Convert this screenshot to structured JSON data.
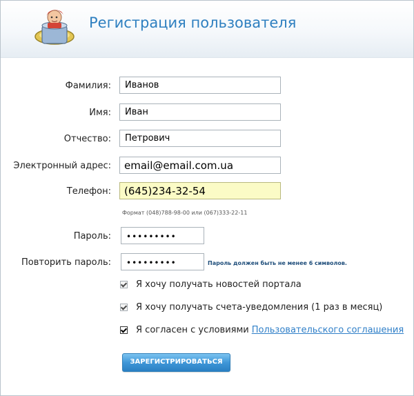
{
  "header": {
    "title": "Регистрация пользователя",
    "logo_icon": "user-hat-logo"
  },
  "form": {
    "lastname": {
      "label": "Фамилия:",
      "value": "Иванов"
    },
    "firstname": {
      "label": "Имя:",
      "value": "Иван"
    },
    "patronymic": {
      "label": "Отчество:",
      "value": "Петрович"
    },
    "email": {
      "label": "Электронный адрес:",
      "value": "email@email.com.ua"
    },
    "phone": {
      "label": "Телефон:",
      "value": "(645)234-32-54",
      "hint": "Формат (048)788-98-00 или (067)333-22-11"
    },
    "password": {
      "label": "Пароль:",
      "value": "•••••••••"
    },
    "password_repeat": {
      "label": "Повторить пароль:",
      "value": "•••••••••",
      "hint": "Пароль должен быть не менее 6 символов."
    }
  },
  "options": {
    "news": {
      "label": "Я хочу получать новостей портала",
      "checked": true
    },
    "invoices": {
      "label": "Я хочу получать счета-уведомления (1 раз в месяц)",
      "checked": true
    },
    "terms": {
      "label": "Я согласен с условиями",
      "link": "Пользовательского соглашения",
      "checked": true
    }
  },
  "submit_label": "ЗАРЕГИСТРИРОВАТЬСЯ",
  "colors": {
    "accent": "#2e7fc0",
    "phone_bg": "#fbfbc6",
    "button": "#3f97d8"
  }
}
